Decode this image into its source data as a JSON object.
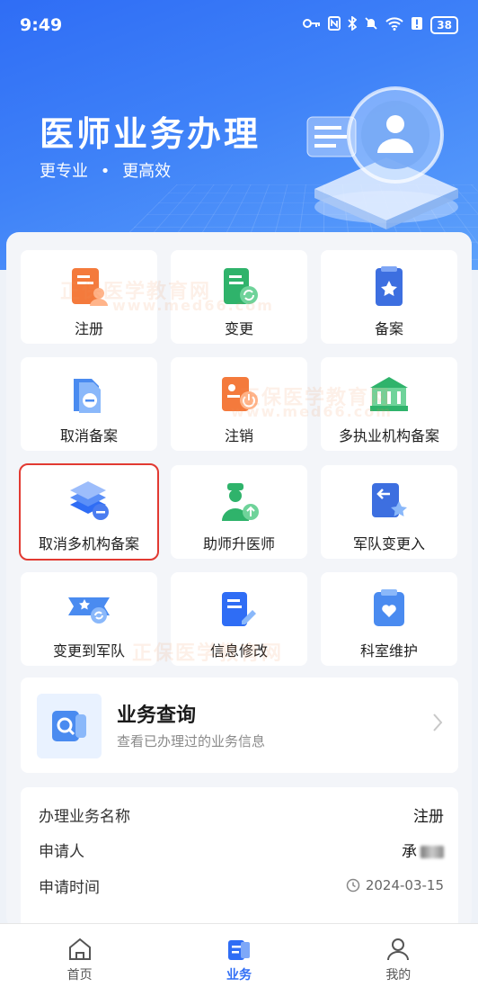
{
  "status_bar": {
    "time": "9:49",
    "battery": "38"
  },
  "hero": {
    "title": "医师业务办理",
    "subtitle_left": "更专业",
    "subtitle_dot": "•",
    "subtitle_right": "更高效"
  },
  "services": [
    {
      "label": "注册",
      "icon": "register-icon"
    },
    {
      "label": "变更",
      "icon": "change-icon"
    },
    {
      "label": "备案",
      "icon": "filing-icon"
    },
    {
      "label": "取消备案",
      "icon": "cancel-filing-icon"
    },
    {
      "label": "注销",
      "icon": "deregister-icon"
    },
    {
      "label": "多执业机构备案",
      "icon": "multi-institution-icon"
    },
    {
      "label": "取消多机构备案",
      "icon": "cancel-multi-institution-icon",
      "selected": true
    },
    {
      "label": "助师升医师",
      "icon": "assistant-upgrade-icon"
    },
    {
      "label": "军队变更入",
      "icon": "military-transfer-in-icon"
    },
    {
      "label": "变更到军队",
      "icon": "transfer-to-military-icon"
    },
    {
      "label": "信息修改",
      "icon": "info-edit-icon"
    },
    {
      "label": "科室维护",
      "icon": "department-maintain-icon"
    }
  ],
  "query": {
    "title": "业务查询",
    "description": "查看已办理过的业务信息"
  },
  "record": {
    "name_label": "办理业务名称",
    "name_value": "注册",
    "applicant_label": "申请人",
    "applicant_value": "承",
    "time_label": "申请时间",
    "time_value": "2024-03-15"
  },
  "tabbar": {
    "home": "首页",
    "business": "业务",
    "mine": "我的"
  },
  "watermark": {
    "brand": "正保医学教育网",
    "url": "www.med66.com"
  },
  "colors": {
    "primary": "#2f6df5",
    "selected_border": "#e23a32",
    "orange": "#f47a3c",
    "green": "#3cb371"
  }
}
